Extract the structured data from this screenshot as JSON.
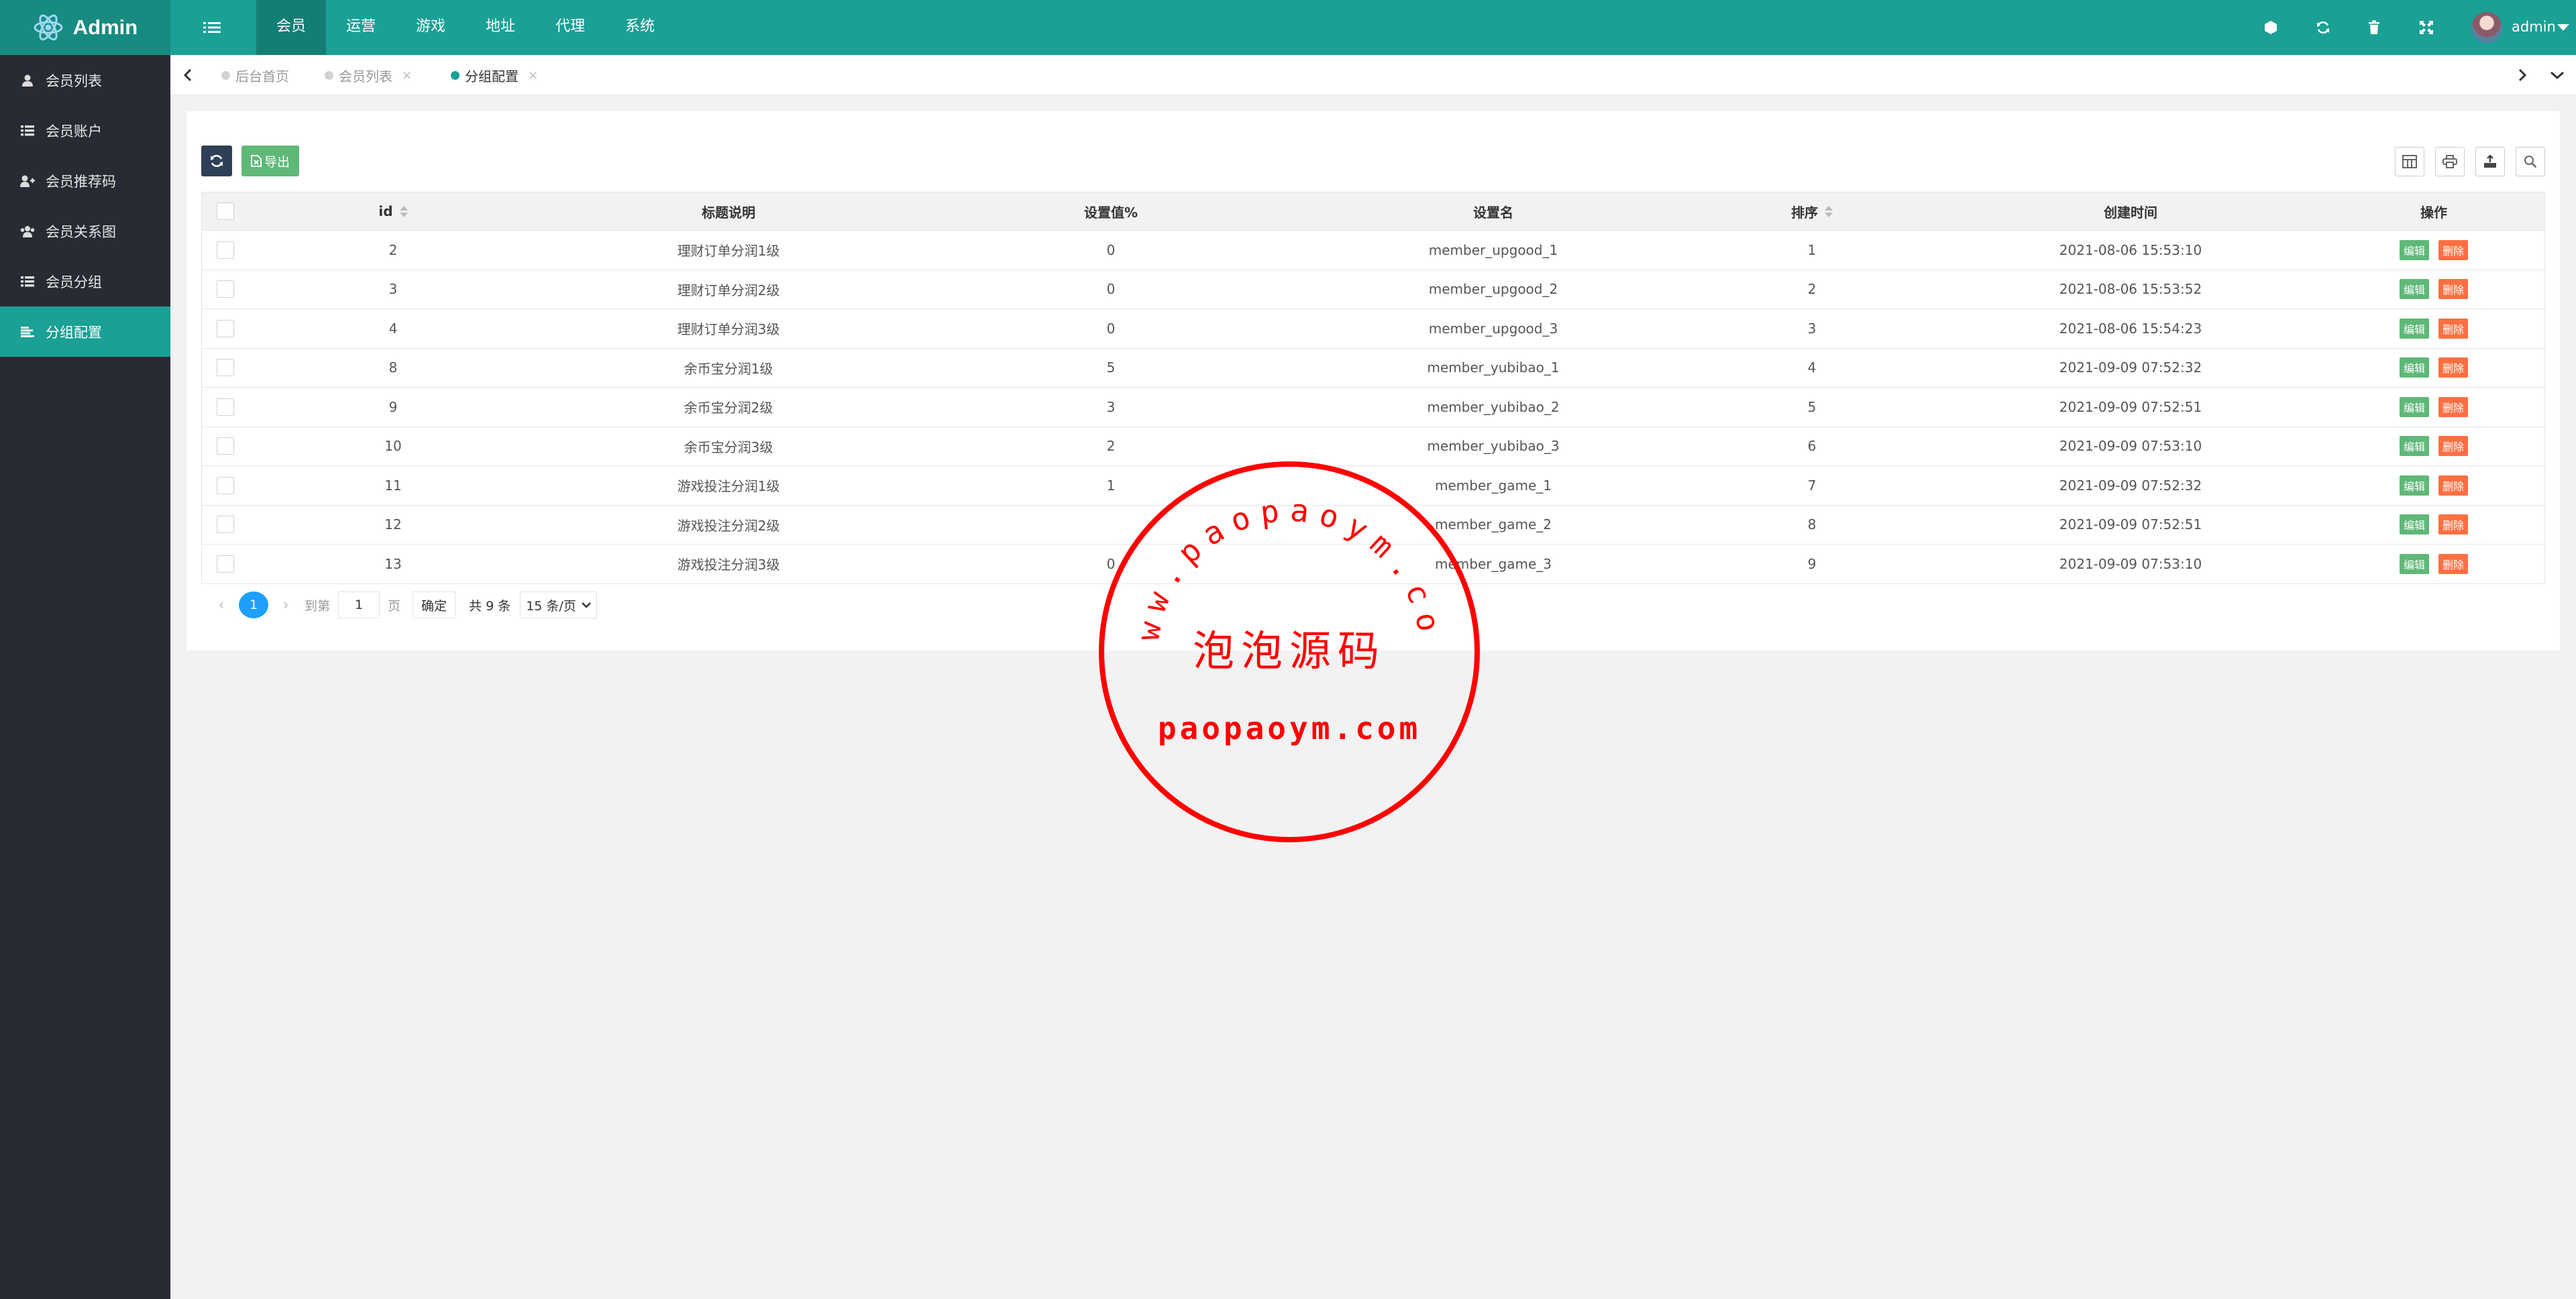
{
  "app": {
    "title": "Admin",
    "user": "admin"
  },
  "colors": {
    "primary": "#1aa094",
    "sidebar": "#272b33",
    "edit": "#5fb878",
    "delete": "#ff5722",
    "page_current": "#1e9fff",
    "stamp": "#ff0000"
  },
  "topnav": [
    {
      "label": "会员",
      "active": true
    },
    {
      "label": "运营"
    },
    {
      "label": "游戏"
    },
    {
      "label": "地址"
    },
    {
      "label": "代理"
    },
    {
      "label": "系统"
    }
  ],
  "top_icons": [
    "theme-icon",
    "refresh-icon",
    "trash-icon",
    "fullscreen-icon"
  ],
  "sidebar": {
    "items": [
      {
        "label": "会员列表",
        "icon": "user-icon"
      },
      {
        "label": "会员账户",
        "icon": "list-icon"
      },
      {
        "label": "会员推荐码",
        "icon": "user-plus-icon"
      },
      {
        "label": "会员关系图",
        "icon": "users-icon"
      },
      {
        "label": "会员分组",
        "icon": "list-icon"
      },
      {
        "label": "分组配置",
        "icon": "align-left-icon",
        "active": true
      }
    ]
  },
  "tabs": [
    {
      "label": "后台首页"
    },
    {
      "label": "会员列表",
      "close": "×"
    },
    {
      "label": "分组配置",
      "close": "×",
      "active": true
    }
  ],
  "toolbar": {
    "export_label": "导出"
  },
  "table": {
    "headers": {
      "id": "id",
      "title": "标题说明",
      "value": "设置值%",
      "name": "设置名",
      "sort": "排序",
      "created": "创建时间",
      "ops": "操作"
    },
    "edit_label": "编辑",
    "delete_label": "删除",
    "rows": [
      {
        "id": "2",
        "title": "理财订单分润1级",
        "value": "0",
        "name": "member_upgood_1",
        "sort": "1",
        "created": "2021-08-06 15:53:10"
      },
      {
        "id": "3",
        "title": "理财订单分润2级",
        "value": "0",
        "name": "member_upgood_2",
        "sort": "2",
        "created": "2021-08-06 15:53:52"
      },
      {
        "id": "4",
        "title": "理财订单分润3级",
        "value": "0",
        "name": "member_upgood_3",
        "sort": "3",
        "created": "2021-08-06 15:54:23"
      },
      {
        "id": "8",
        "title": "余币宝分润1级",
        "value": "5",
        "name": "member_yubibao_1",
        "sort": "4",
        "created": "2021-09-09 07:52:32"
      },
      {
        "id": "9",
        "title": "余币宝分润2级",
        "value": "3",
        "name": "member_yubibao_2",
        "sort": "5",
        "created": "2021-09-09 07:52:51"
      },
      {
        "id": "10",
        "title": "余币宝分润3级",
        "value": "2",
        "name": "member_yubibao_3",
        "sort": "6",
        "created": "2021-09-09 07:53:10"
      },
      {
        "id": "11",
        "title": "游戏投注分润1级",
        "value": "1",
        "name": "member_game_1",
        "sort": "7",
        "created": "2021-09-09 07:52:32"
      },
      {
        "id": "12",
        "title": "游戏投注分润2级",
        "value": "",
        "name": "member_game_2",
        "sort": "8",
        "created": "2021-09-09 07:52:51"
      },
      {
        "id": "13",
        "title": "游戏投注分润3级",
        "value": "0",
        "name": "member_game_3",
        "sort": "9",
        "created": "2021-09-09 07:53:10"
      }
    ]
  },
  "pagination": {
    "prev": "‹",
    "next": "›",
    "current": "1",
    "goto_label": "到第",
    "goto_value": "1",
    "page_label": "页",
    "confirm_label": "确定",
    "total_label": "共 9 条",
    "page_size": "15 条/页"
  },
  "watermark": {
    "ring_text": "www.paopaoym.com",
    "center_text": "泡泡源码",
    "bottom_text": "paopaoym.com"
  }
}
